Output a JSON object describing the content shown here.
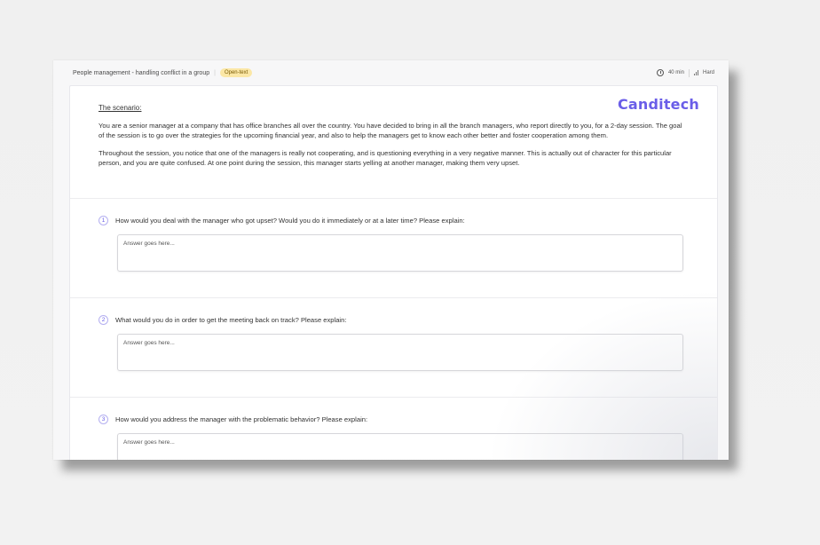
{
  "header": {
    "title": "People management - handling conflict in a group",
    "badge": "Open-text",
    "duration": "40 min",
    "difficulty": "Hard"
  },
  "brand": {
    "name": "Canditech",
    "color": "#6a5ee8"
  },
  "scenario": {
    "heading": "The scenario:",
    "paragraphs": [
      "You are a senior manager at a company that has office branches all over the country. You have decided to bring in all the branch managers, who report directly to you, for a 2-day session. The goal of the session is to go over the strategies for the upcoming financial year, and also to help the managers get to know each other better and foster cooperation among them.",
      "Throughout the session, you notice that one of the managers is really not cooperating, and is questioning everything in a very negative manner. This is actually out of character for this particular person, and you are quite confused. At one point during the session, this manager starts yelling at another manager, making them very upset."
    ]
  },
  "questions": [
    {
      "number": "1",
      "text": "How would you deal with the manager who got upset? Would you do it immediately or at a later time? Please explain:",
      "placeholder": "Answer goes here..."
    },
    {
      "number": "2",
      "text": "What would you do in order to get the meeting back on track? Please explain:",
      "placeholder": "Answer goes here..."
    },
    {
      "number": "3",
      "text": "How would you address the manager with the problematic behavior? Please explain:",
      "placeholder": "Answer goes here..."
    }
  ],
  "icons": {
    "duration": "clock-icon",
    "difficulty": "signal-bars-icon"
  }
}
